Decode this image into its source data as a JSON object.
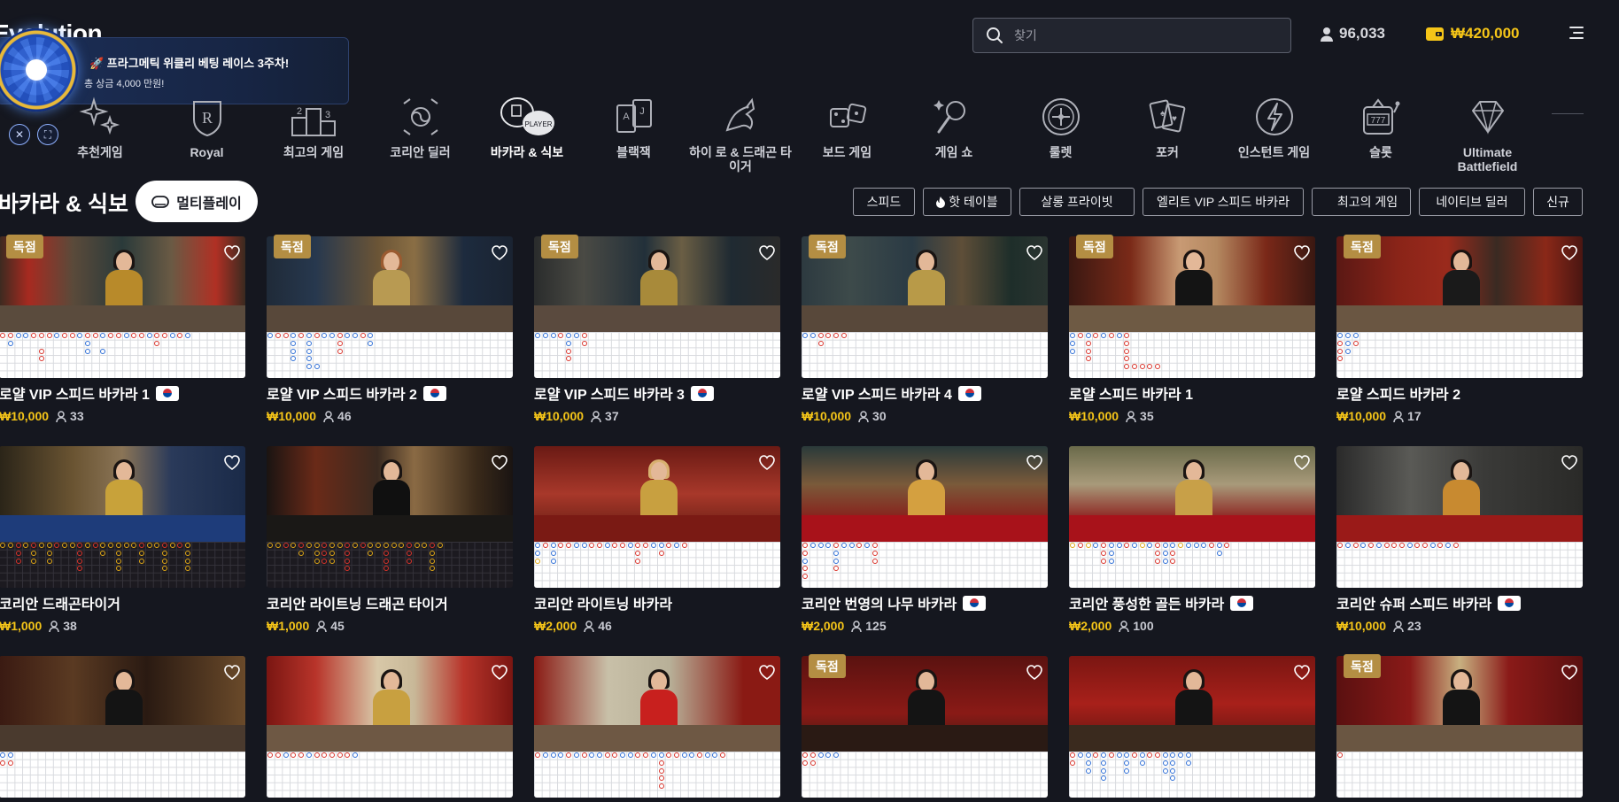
{
  "header": {
    "logo": "Evolution",
    "search_placeholder": "찾기",
    "players": "96,033",
    "balance": "₩420,000"
  },
  "promo": {
    "title": "🚀 프라그메틱 위클리 베팅 레이스 3주차!",
    "subtitle": "총 상금 4,000 만원!"
  },
  "categories": [
    {
      "label": "추천게임",
      "icon": "sparkles-icon"
    },
    {
      "label": "Royal",
      "icon": "royal-crest-icon"
    },
    {
      "label": "최고의 게임",
      "icon": "podium-icon"
    },
    {
      "label": "코리안 딜러",
      "icon": "korea-emblem-icon"
    },
    {
      "label": "바카라 & 식보",
      "icon": "baccarat-chips-icon",
      "active": true
    },
    {
      "label": "블랙잭",
      "icon": "cards-icon"
    },
    {
      "label": "하이 로 & 드래곤 타이거",
      "icon": "dragon-icon"
    },
    {
      "label": "보드 게임",
      "icon": "dice-icon"
    },
    {
      "label": "게임 쇼",
      "icon": "microphone-icon"
    },
    {
      "label": "룰렛",
      "icon": "roulette-icon"
    },
    {
      "label": "포커",
      "icon": "poker-cards-icon"
    },
    {
      "label": "인스턴트 게임",
      "icon": "lightning-icon"
    },
    {
      "label": "슬롯",
      "icon": "slot-machine-icon"
    },
    {
      "label": "Ultimate Battlefield",
      "icon": "diamond-icon"
    }
  ],
  "section": {
    "title": "바카라 & 식보",
    "multiplay": "멀티플레이"
  },
  "filters": [
    {
      "label": "스피드",
      "icon": ""
    },
    {
      "label": "핫 테이블",
      "icon": "flame-icon"
    },
    {
      "label": "살롱 프라이빗",
      "icon": ""
    },
    {
      "label": "엘리트 VIP 스피드 바카라",
      "icon": ""
    },
    {
      "label": "최고의 게임",
      "icon": "crescent-icon"
    },
    {
      "label": "네이티브 딜러",
      "icon": ""
    },
    {
      "label": "신규",
      "icon": ""
    }
  ],
  "badge_label": "독점",
  "games": [
    {
      "name": "로얄 VIP 스피드 바카라 1",
      "price": "₩10,000",
      "players": "33",
      "exclusive": true,
      "flag": true
    },
    {
      "name": "로얄 VIP 스피드 바카라 2",
      "price": "₩10,000",
      "players": "46",
      "exclusive": true,
      "flag": true
    },
    {
      "name": "로얄 VIP 스피드 바카라 3",
      "price": "₩10,000",
      "players": "37",
      "exclusive": true,
      "flag": true
    },
    {
      "name": "로얄 VIP 스피드 바카라 4",
      "price": "₩10,000",
      "players": "30",
      "exclusive": true,
      "flag": true
    },
    {
      "name": "로얄 스피드 바카라 1",
      "price": "₩10,000",
      "players": "35",
      "exclusive": true,
      "flag": false
    },
    {
      "name": "로얄 스피드 바카라 2",
      "price": "₩10,000",
      "players": "17",
      "exclusive": true,
      "flag": false
    },
    {
      "name": "코리안 드래곤타이거",
      "price": "₩1,000",
      "players": "38",
      "exclusive": false,
      "flag": false
    },
    {
      "name": "코리안 라이트닝 드래곤 타이거",
      "price": "₩1,000",
      "players": "45",
      "exclusive": false,
      "flag": false
    },
    {
      "name": "코리안 라이트닝 바카라",
      "price": "₩2,000",
      "players": "46",
      "exclusive": false,
      "flag": false
    },
    {
      "name": "코리안 번영의 나무 바카라",
      "price": "₩2,000",
      "players": "125",
      "exclusive": false,
      "flag": true
    },
    {
      "name": "코리안 풍성한 골든 바카라",
      "price": "₩2,000",
      "players": "100",
      "exclusive": false,
      "flag": true
    },
    {
      "name": "코리안 슈퍼 스피드 바카라",
      "price": "₩10,000",
      "players": "23",
      "exclusive": false,
      "flag": true
    },
    {
      "name": "",
      "price": "",
      "players": "",
      "exclusive": false,
      "flag": false
    },
    {
      "name": "",
      "price": "",
      "players": "",
      "exclusive": false,
      "flag": false
    },
    {
      "name": "",
      "price": "",
      "players": "",
      "exclusive": false,
      "flag": false
    },
    {
      "name": "",
      "price": "",
      "players": "",
      "exclusive": true,
      "flag": false
    },
    {
      "name": "",
      "price": "",
      "players": "",
      "exclusive": false,
      "flag": false
    },
    {
      "name": "",
      "price": "",
      "players": "",
      "exclusive": true,
      "flag": false
    }
  ],
  "colors": {
    "accent": "#f5c518",
    "badge": "#b48e43",
    "background": "#15171f",
    "banker_red": "#d9342b",
    "player_blue": "#2f6fd6"
  }
}
